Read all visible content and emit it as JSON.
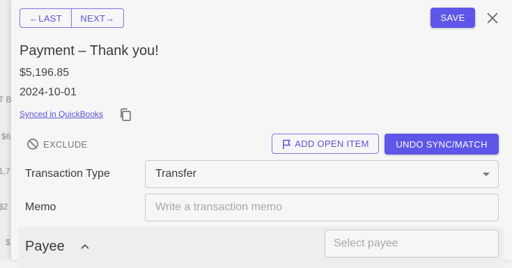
{
  "background": {
    "fragments": [
      "T B",
      "$6",
      "1,7",
      "$2",
      "$"
    ]
  },
  "nav": {
    "last_label": "←LAST",
    "next_label": "NEXT→"
  },
  "toolbar": {
    "save_label": "SAVE",
    "close_icon": "close-icon"
  },
  "transaction": {
    "title": "Payment – Thank you!",
    "amount": "$5,196.85",
    "date": "2024-10-01",
    "synced_text": "Synced in QuickBooks"
  },
  "actions": {
    "exclude_label": "EXCLUDE",
    "add_open_item_label": "ADD OPEN ITEM",
    "undo_sync_label": "UNDO SYNC/MATCH"
  },
  "form": {
    "transaction_type_label": "Transaction Type",
    "transaction_type_value": "Transfer",
    "memo_label": "Memo",
    "memo_placeholder": "Write a transaction memo"
  },
  "payee": {
    "section_label": "Payee",
    "placeholder": "Select payee"
  },
  "colors": {
    "accent": "#5e56e8",
    "accent_text": "#5b52d6",
    "panel_bg": "#f6f6f6"
  }
}
